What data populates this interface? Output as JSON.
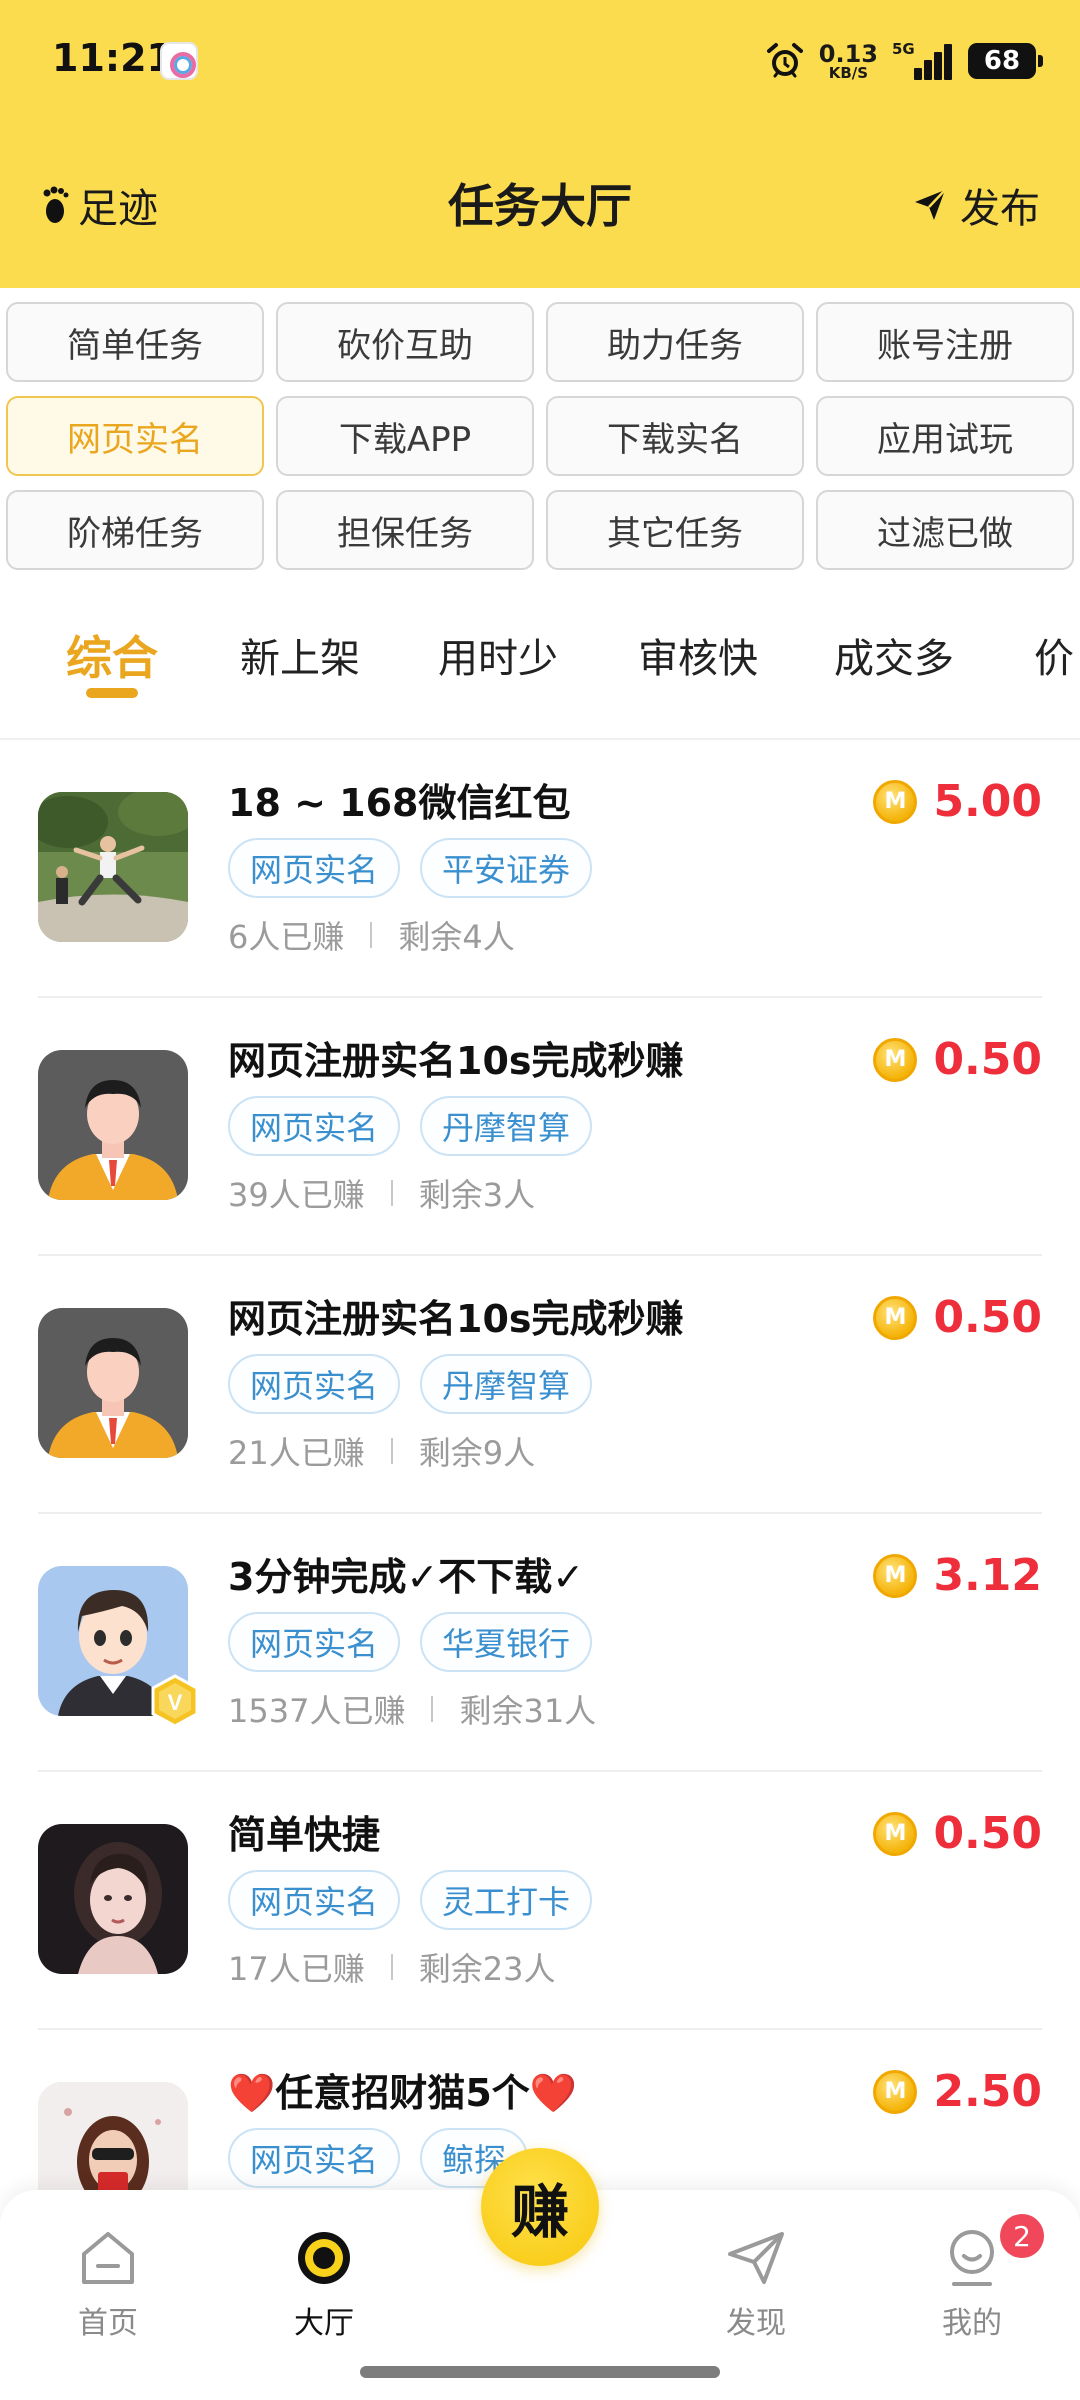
{
  "status_bar": {
    "time": "11:21",
    "speed_value": "0.13",
    "speed_unit": "KB/S",
    "network": "5G",
    "battery": "68"
  },
  "nav": {
    "left_label": "足迹",
    "title": "任务大厅",
    "right_label": "发布"
  },
  "categories": [
    {
      "label": "简单任务",
      "active": false
    },
    {
      "label": "砍价互助",
      "active": false
    },
    {
      "label": "助力任务",
      "active": false
    },
    {
      "label": "账号注册",
      "active": false
    },
    {
      "label": "网页实名",
      "active": true
    },
    {
      "label": "下载APP",
      "active": false
    },
    {
      "label": "下载实名",
      "active": false
    },
    {
      "label": "应用试玩",
      "active": false
    },
    {
      "label": "阶梯任务",
      "active": false
    },
    {
      "label": "担保任务",
      "active": false
    },
    {
      "label": "其它任务",
      "active": false
    },
    {
      "label": "过滤已做",
      "active": false
    }
  ],
  "sort_tabs": [
    "综合",
    "新上架",
    "用时少",
    "审核快",
    "成交多",
    "价"
  ],
  "tasks": [
    {
      "title": "18 ~ 168微信红包",
      "tags": [
        "网页实名",
        "平安证券"
      ],
      "earned": "6人已赚",
      "remaining": "剩余4人",
      "price": "5.00"
    },
    {
      "title": "网页注册实名10s完成秒赚",
      "tags": [
        "网页实名",
        "丹摩智算"
      ],
      "earned": "39人已赚",
      "remaining": "剩余3人",
      "price": "0.50"
    },
    {
      "title": "网页注册实名10s完成秒赚",
      "tags": [
        "网页实名",
        "丹摩智算"
      ],
      "earned": "21人已赚",
      "remaining": "剩余9人",
      "price": "0.50"
    },
    {
      "title": "3分钟完成✓不下载✓",
      "tags": [
        "网页实名",
        "华夏银行"
      ],
      "earned": "1537人已赚",
      "remaining": "剩余31人",
      "price": "3.12"
    },
    {
      "title": "简单快捷",
      "tags": [
        "网页实名",
        "灵工打卡"
      ],
      "earned": "17人已赚",
      "remaining": "剩余23人",
      "price": "0.50"
    },
    {
      "title": "❤️任意招财猫5个❤️",
      "tags": [
        "网页实名",
        "鲸探"
      ],
      "earned": "",
      "remaining": "",
      "price": "2.50"
    }
  ],
  "coin_symbol": "M",
  "vip_symbol": "V",
  "tabbar": {
    "home": "首页",
    "hall": "大厅",
    "earn": "赚",
    "discover": "发现",
    "mine": "我的",
    "mine_badge": "2"
  },
  "colors": {
    "header": "#fbdc4f",
    "accent": "#eaa61e",
    "price": "#ee2e3b",
    "tag": "#3a8fcf"
  }
}
